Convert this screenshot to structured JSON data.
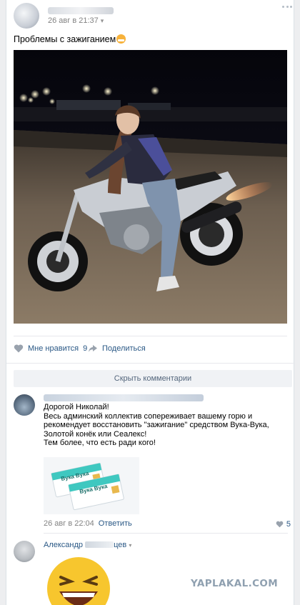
{
  "post": {
    "date": "26 авг в 21:37",
    "text": "Проблемы с зажиганием",
    "more_icon": "more-dots-icon"
  },
  "actions": {
    "like_label": "Мне нравится",
    "like_count": "9",
    "share_label": "Поделиться"
  },
  "comments_toggle": "Скрыть комментарии",
  "comments": [
    {
      "lines": [
        "Дорогой Николай!",
        "Весь админский коллектив сопереживает вашему горю и рекомендует восстановить \"зажигание\" средством Вука-Вука, Золотой конёк или Сеалекс!",
        "Тем более, что есть ради кого!"
      ],
      "product_label": "Вука Вука",
      "date": "26 авг в 22:04",
      "reply_label": "Ответить",
      "likes": "5"
    },
    {
      "author": "Александр",
      "author_suffix": "цев"
    }
  ],
  "watermark": "YAPLAKAL.COM",
  "colors": {
    "link": "#2a5885",
    "meta": "#828282",
    "icon": "#99a2ad",
    "background": "#edeef0",
    "product_teal": "#3fc8c0"
  }
}
